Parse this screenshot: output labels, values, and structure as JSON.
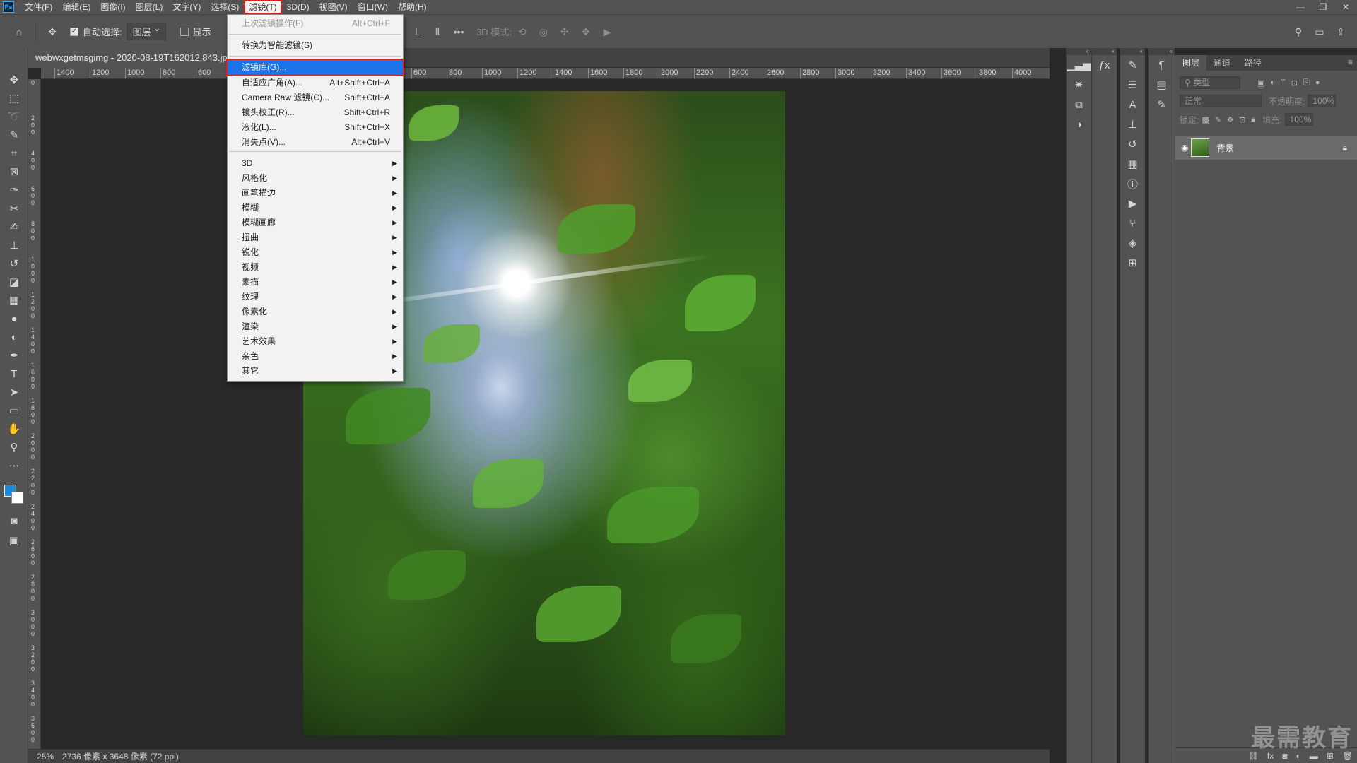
{
  "menubar": {
    "logo": "Ps",
    "items": [
      "文件(F)",
      "编辑(E)",
      "图像(I)",
      "图层(L)",
      "文字(Y)",
      "选择(S)",
      "滤镜(T)",
      "3D(D)",
      "视图(V)",
      "窗口(W)",
      "帮助(H)"
    ],
    "active_index": 6,
    "window_controls": [
      "—",
      "❐",
      "✕"
    ]
  },
  "options": {
    "auto_select_label": "自动选择:",
    "auto_select_value": "图层",
    "show_transform_label": "显示",
    "mode_3d_label": "3D 模式:",
    "more": "•••"
  },
  "document": {
    "tab_title": "webwxgetmsgimg - 2020-08-19T162012.843.jpg",
    "ruler_left": [
      "1400",
      "1200",
      "1000",
      "800",
      "600"
    ],
    "ruler_right": [
      "600",
      "800",
      "1000",
      "1200",
      "1400",
      "1600",
      "1800",
      "2000",
      "2200",
      "2400",
      "2600",
      "2800",
      "3000",
      "3200",
      "3400",
      "3600",
      "3800",
      "4000"
    ],
    "ruler_v": [
      "0",
      "200",
      "400",
      "600",
      "800",
      "1000",
      "1200",
      "1400",
      "1600",
      "1800",
      "2000",
      "2200",
      "2400",
      "2600",
      "2800",
      "3000",
      "3200",
      "3400",
      "3600"
    ],
    "zoom": "25%",
    "size_info": "2736 像素 x 3648 像素 (72 ppi)"
  },
  "filter_menu": {
    "last_filter": {
      "label": "上次滤镜操作(F)",
      "shortcut": "Alt+Ctrl+F"
    },
    "smart": "转换为智能滤镜(S)",
    "gallery": "滤镜库(G)...",
    "commands": [
      {
        "label": "自适应广角(A)...",
        "shortcut": "Alt+Shift+Ctrl+A"
      },
      {
        "label": "Camera Raw 滤镜(C)...",
        "shortcut": "Shift+Ctrl+A"
      },
      {
        "label": "镜头校正(R)...",
        "shortcut": "Shift+Ctrl+R"
      },
      {
        "label": "液化(L)...",
        "shortcut": "Shift+Ctrl+X"
      },
      {
        "label": "消失点(V)...",
        "shortcut": "Alt+Ctrl+V"
      }
    ],
    "submenus": [
      "3D",
      "风格化",
      "画笔描边",
      "模糊",
      "模糊画廊",
      "扭曲",
      "锐化",
      "视频",
      "素描",
      "纹理",
      "像素化",
      "渲染",
      "艺术效果",
      "杂色",
      "其它"
    ]
  },
  "layers_panel": {
    "tabs": [
      "图层",
      "通道",
      "路径"
    ],
    "filter_placeholder": "类型",
    "blend_mode": "正常",
    "opacity_label": "不透明度:",
    "opacity_value": "100%",
    "lock_label": "锁定:",
    "fill_label": "填充:",
    "fill_value": "100%",
    "layer_name": "背景"
  },
  "watermark": "最需教育"
}
